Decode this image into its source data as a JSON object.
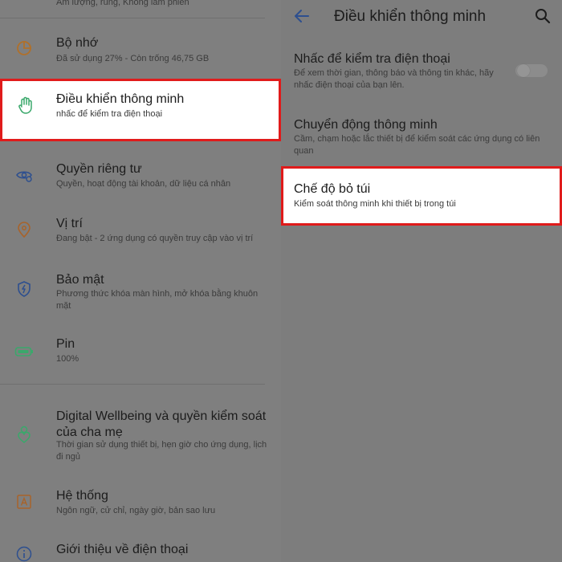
{
  "colors": {
    "highlight_border": "#e01b1b",
    "accent_blue": "#2d4f8f",
    "hand_icon_green": "#3aa86b"
  },
  "left": {
    "items": [
      {
        "title": "",
        "subtitle": "Âm lượng, rung, Không làm phiền",
        "icon": "none"
      },
      {
        "title": "Bộ nhớ",
        "subtitle": "Đã sử dụng 27% - Còn trống 46,75 GB",
        "icon": "storage-pie-icon"
      },
      {
        "title": "Điều khiển thông minh",
        "subtitle": "nhấc để kiểm tra điện thoại",
        "icon": "hand-icon"
      },
      {
        "title": "Quyền riêng tư",
        "subtitle": "Quyền, hoạt động tài khoản, dữ liệu cá nhân",
        "icon": "privacy-eye-icon"
      },
      {
        "title": "Vị trí",
        "subtitle": "Đang bật - 2 ứng dụng có quyền truy cập vào vị trí",
        "icon": "location-pin-icon"
      },
      {
        "title": "Bảo mật",
        "subtitle": "Phương thức khóa màn hình, mở khóa bằng khuôn mặt",
        "icon": "shield-icon"
      },
      {
        "title": "Pin",
        "subtitle": "100%",
        "icon": "battery-icon"
      },
      {
        "title": "Digital Wellbeing và quyền kiểm soát của cha mẹ",
        "subtitle": "Thời gian sử dụng thiết bị, hẹn giờ cho ứng dụng, lịch đi ngủ",
        "icon": "wellbeing-person-icon"
      },
      {
        "title": "Hệ thống",
        "subtitle": "Ngôn ngữ, cử chỉ, ngày giờ, bản sao lưu",
        "icon": "system-a-icon"
      },
      {
        "title": "Giới thiệu về điện thoại",
        "subtitle": "",
        "icon": "info-icon"
      }
    ]
  },
  "right": {
    "appbar": {
      "title": "Điều khiển thông minh"
    },
    "items": [
      {
        "title": "Nhấc để kiểm tra điện thoại",
        "subtitle": "Để xem thời gian, thông báo và thông tin khác, hãy nhấc điện thoại của bạn lên.",
        "toggle": "off"
      },
      {
        "title": "Chuyển động thông minh",
        "subtitle": "Cầm, chạm hoặc lắc thiết bị để kiểm soát các ứng dụng có liên quan"
      },
      {
        "title": "Chế độ bỏ túi",
        "subtitle": "Kiểm soát thông minh khi thiết bị trong túi"
      }
    ]
  }
}
